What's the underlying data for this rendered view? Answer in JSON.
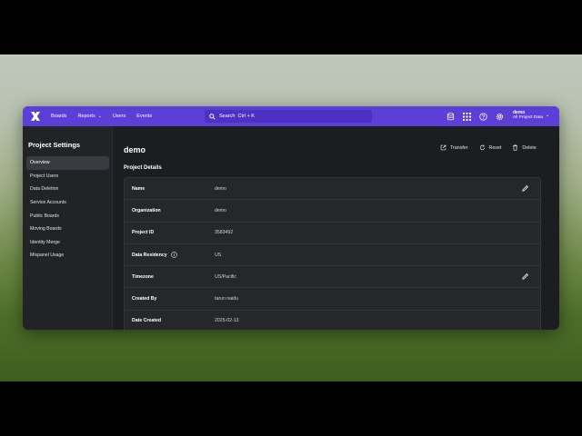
{
  "topbar": {
    "nav": [
      {
        "label": "Boards"
      },
      {
        "label": "Reports",
        "has_dropdown": true
      },
      {
        "label": "Users"
      },
      {
        "label": "Events"
      }
    ],
    "search": {
      "placeholder": "Search  Ctrl + K"
    },
    "icons": [
      "database-icon",
      "apps-grid-icon",
      "help-icon",
      "settings-icon"
    ],
    "account": {
      "name": "demo",
      "project": "All Project Data"
    }
  },
  "sidebar": {
    "title": "Project Settings",
    "items": [
      {
        "label": "Overview",
        "active": true
      },
      {
        "label": "Project Users"
      },
      {
        "label": "Data Deletion"
      },
      {
        "label": "Service Accounts"
      },
      {
        "label": "Public Boards"
      },
      {
        "label": "Moving Boards"
      },
      {
        "label": "Identity Merge"
      },
      {
        "label": "Mixpanel Usage"
      }
    ]
  },
  "main": {
    "project_name": "demo",
    "actions": {
      "transfer": "Transfer",
      "reset": "Reset",
      "delete": "Delete"
    },
    "section_title": "Project Details",
    "details": [
      {
        "label": "Name",
        "value": "demo",
        "editable": true
      },
      {
        "label": "Organization",
        "value": "demo"
      },
      {
        "label": "Project ID",
        "value": "3583492"
      },
      {
        "label": "Data Residency",
        "value": "US",
        "info": true
      },
      {
        "label": "Timezone",
        "value": "US/Pacific",
        "editable": true
      },
      {
        "label": "Created By",
        "value": "tarun naidu"
      },
      {
        "label": "Date Created",
        "value": "2025-02-13"
      }
    ]
  },
  "colors": {
    "brand": "#5b3fd6",
    "window_bg": "#1b1d20",
    "sidebar_bg": "#212326",
    "card_bg": "#25272b"
  }
}
